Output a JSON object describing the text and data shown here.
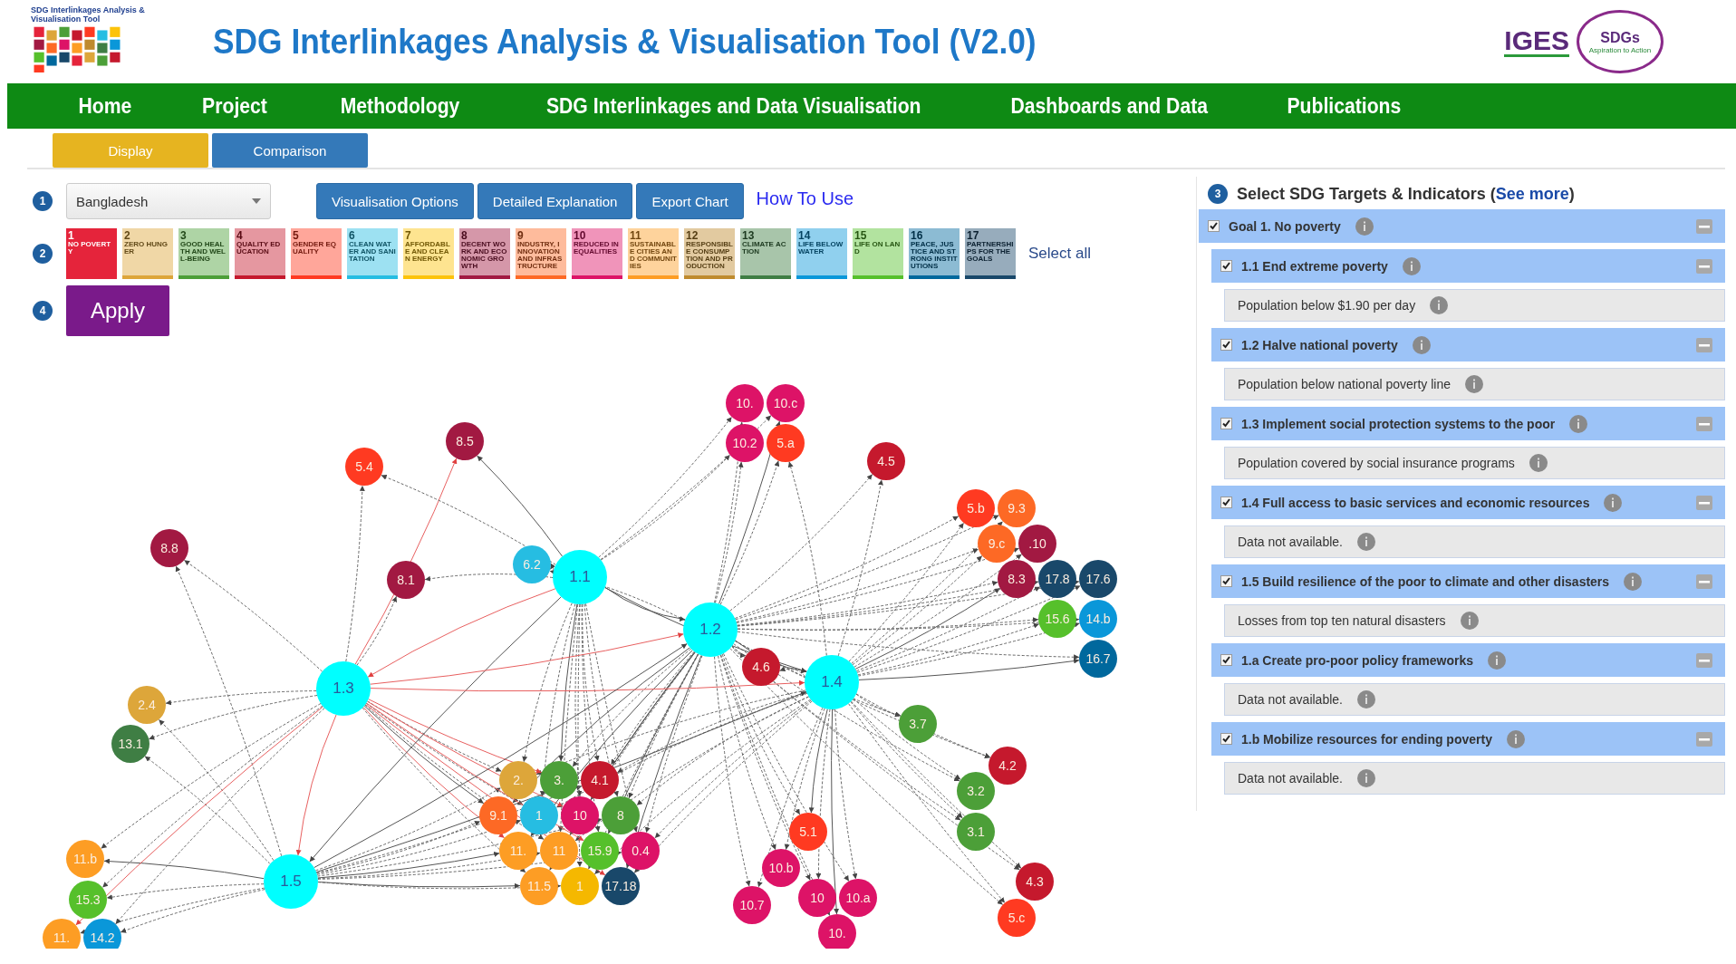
{
  "header": {
    "logo_lines": [
      "SDG Interlinkages Analysis &",
      "Visualisation Tool"
    ],
    "title": "SDG Interlinkages Analysis & Visualisation Tool (V2.0)",
    "partner": {
      "name": "IGES",
      "badge": "SDGs",
      "tagline": "Aspiration to Action"
    }
  },
  "nav": {
    "items": [
      "Home",
      "Project",
      "Methodology",
      "SDG Interlinkages and Data Visualisation",
      "Dashboards and Data",
      "Publications"
    ]
  },
  "view_tabs": [
    {
      "label": "Display",
      "selected": true
    },
    {
      "label": "Comparison",
      "selected": false
    }
  ],
  "controls": {
    "country": {
      "step": "1",
      "value": "Bangladesh"
    },
    "buttons": [
      "Visualisation Options",
      "Detailed Explanation",
      "Export Chart"
    ],
    "help_link": "How To Use",
    "goals": {
      "step": "2",
      "select_all": "Select all",
      "items": [
        {
          "number": "1",
          "title": "NO POVERTY",
          "color": "#e5243b",
          "selected": true
        },
        {
          "number": "2",
          "title": "ZERO HUNGER",
          "color": "#dda63a",
          "selected": false
        },
        {
          "number": "3",
          "title": "GOOD HEALTH AND WELL-BEING",
          "color": "#4c9f38",
          "selected": false
        },
        {
          "number": "4",
          "title": "QUALITY EDUCATION",
          "color": "#c5192d",
          "selected": false
        },
        {
          "number": "5",
          "title": "GENDER EQUALITY",
          "color": "#ff3a21",
          "selected": false
        },
        {
          "number": "6",
          "title": "CLEAN WATER AND SANITATION",
          "color": "#26bde2",
          "selected": false
        },
        {
          "number": "7",
          "title": "AFFORDABLE AND CLEAN ENERGY",
          "color": "#fcc30b",
          "selected": false
        },
        {
          "number": "8",
          "title": "DECENT WORK AND ECONOMIC GROWTH",
          "color": "#a21942",
          "selected": false
        },
        {
          "number": "9",
          "title": "INDUSTRY, INNOVATION AND INFRASTRUCTURE",
          "color": "#fd6925",
          "selected": false
        },
        {
          "number": "10",
          "title": "REDUCED INEQUALITIES",
          "color": "#dd1367",
          "selected": false
        },
        {
          "number": "11",
          "title": "SUSTAINABLE CITIES AND COMMUNITIES",
          "color": "#fd9d24",
          "selected": false
        },
        {
          "number": "12",
          "title": "RESPONSIBLE CONSUMPTION AND PRODUCTION",
          "color": "#bf8b2e",
          "selected": false
        },
        {
          "number": "13",
          "title": "CLIMATE ACTION",
          "color": "#3f7e44",
          "selected": false
        },
        {
          "number": "14",
          "title": "LIFE BELOW WATER",
          "color": "#0a97d9",
          "selected": false
        },
        {
          "number": "15",
          "title": "LIFE ON LAND",
          "color": "#56c02b",
          "selected": false
        },
        {
          "number": "16",
          "title": "PEACE, JUSTICE AND STRONG INSTITUTIONS",
          "color": "#00689d",
          "selected": false
        },
        {
          "number": "17",
          "title": "PARTNERSHIPS FOR THE GOALS",
          "color": "#19486a",
          "selected": false
        }
      ]
    },
    "apply": {
      "step": "4",
      "label": "Apply"
    }
  },
  "graph": {
    "nodes": [
      {
        "label": "8.5",
        "color": "#a21942"
      },
      {
        "label": "5.4",
        "color": "#ff3a21"
      },
      {
        "label": "8.8",
        "color": "#a21942"
      },
      {
        "label": "8.1",
        "color": "#a21942"
      },
      {
        "label": "6.2",
        "color": "#26bde2"
      },
      {
        "label": "1.1",
        "color": "#00ffff"
      },
      {
        "label": "1.3",
        "color": "#00ffff"
      },
      {
        "label": "2.4",
        "color": "#dda63a"
      },
      {
        "label": "13.1",
        "color": "#3f7e44"
      },
      {
        "label": "1.5",
        "color": "#00ffff"
      },
      {
        "label": "11.b",
        "color": "#fd9d24"
      },
      {
        "label": "15.3",
        "color": "#56c02b"
      },
      {
        "label": "11.",
        "color": "#fd9d24"
      },
      {
        "label": "14.2",
        "color": "#0a97d9"
      },
      {
        "label": "2.",
        "color": "#dda63a"
      },
      {
        "label": "3.",
        "color": "#4c9f38"
      },
      {
        "label": "4.1",
        "color": "#c5192d"
      },
      {
        "label": "9.1",
        "color": "#fd6925"
      },
      {
        "label": "1",
        "color": "#26bde2"
      },
      {
        "label": "10",
        "color": "#dd1367"
      },
      {
        "label": "8",
        "color": "#4c9f38"
      },
      {
        "label": "11.",
        "color": "#fd9d24"
      },
      {
        "label": "11",
        "color": "#fd9d24"
      },
      {
        "label": "15.9",
        "color": "#56c02b"
      },
      {
        "label": "0.4",
        "color": "#dd1367"
      },
      {
        "label": "11.5",
        "color": "#fd9d24"
      },
      {
        "label": "1",
        "color": "#f5b800"
      },
      {
        "label": "17.18",
        "color": "#19486a"
      },
      {
        "label": "10.",
        "color": "#dd1367"
      },
      {
        "label": "10.2",
        "color": "#dd1367"
      },
      {
        "label": "10.c",
        "color": "#dd1367"
      },
      {
        "label": "5.a",
        "color": "#ff3a21"
      },
      {
        "label": "4.5",
        "color": "#c5192d"
      },
      {
        "label": "1.2",
        "color": "#00ffff"
      },
      {
        "label": "4.6",
        "color": "#c5192d"
      },
      {
        "label": "1.4",
        "color": "#00ffff"
      },
      {
        "label": "5.b",
        "color": "#ff3a21"
      },
      {
        "label": "9.3",
        "color": "#fd6925"
      },
      {
        "label": "9.c",
        "color": "#fd6925"
      },
      {
        "label": ".10",
        "color": "#a21942"
      },
      {
        "label": "8.3",
        "color": "#a21942"
      },
      {
        "label": "17.8",
        "color": "#19486a"
      },
      {
        "label": "17.6",
        "color": "#19486a"
      },
      {
        "label": "15.6",
        "color": "#56c02b"
      },
      {
        "label": "14.b",
        "color": "#0a97d9"
      },
      {
        "label": "16.7",
        "color": "#00689d"
      },
      {
        "label": "3.7",
        "color": "#4c9f38"
      },
      {
        "label": "4.2",
        "color": "#c5192d"
      },
      {
        "label": "3.2",
        "color": "#4c9f38"
      },
      {
        "label": "3.1",
        "color": "#4c9f38"
      },
      {
        "label": "5.1",
        "color": "#ff3a21"
      },
      {
        "label": "10.b",
        "color": "#dd1367"
      },
      {
        "label": "10.7",
        "color": "#dd1367"
      },
      {
        "label": "10",
        "color": "#dd1367"
      },
      {
        "label": "10.a",
        "color": "#dd1367"
      },
      {
        "label": "10.",
        "color": "#dd1367"
      },
      {
        "label": "4.3",
        "color": "#c5192d"
      },
      {
        "label": "5.c",
        "color": "#ff3a21"
      }
    ]
  },
  "targets_panel": {
    "step": "3",
    "title": "Select SDG Targets & Indicators",
    "paren_open": "(",
    "link": "See more",
    "paren_close": ")",
    "goals": [
      {
        "label": "Goal 1. No poverty",
        "checked": true,
        "expanded": true,
        "children": [
          {
            "label": "1.1 End extreme poverty",
            "checked": true,
            "expanded": true,
            "children": [
              {
                "label": "Population below $1.90 per day"
              }
            ]
          },
          {
            "label": "1.2 Halve national poverty",
            "checked": true,
            "expanded": true,
            "children": [
              {
                "label": "Population below national poverty line"
              }
            ]
          },
          {
            "label": "1.3 Implement social protection systems to the poor",
            "checked": true,
            "expanded": true,
            "children": [
              {
                "label": "Population covered by social insurance programs"
              }
            ]
          },
          {
            "label": "1.4 Full access to basic services and economic resources",
            "checked": true,
            "expanded": true,
            "children": [
              {
                "label": "Data not available."
              }
            ]
          },
          {
            "label": "1.5 Build resilience of the poor to climate and other disasters",
            "checked": true,
            "expanded": true,
            "children": [
              {
                "label": "Losses from top ten natural disasters"
              }
            ]
          },
          {
            "label": "1.a Create pro-poor policy frameworks",
            "checked": true,
            "expanded": true,
            "children": [
              {
                "label": "Data not available."
              }
            ]
          },
          {
            "label": "1.b Mobilize resources for ending poverty",
            "checked": true,
            "expanded": true,
            "children": [
              {
                "label": "Data not available."
              }
            ]
          }
        ]
      }
    ]
  }
}
